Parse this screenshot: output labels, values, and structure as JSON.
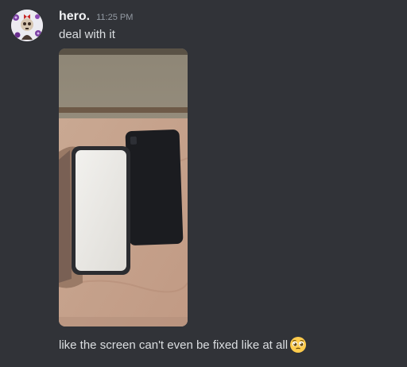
{
  "message": {
    "author": {
      "username": "hero.",
      "avatar_icon": "avatar-skull-flowers-icon"
    },
    "timestamp": "11:25 PM",
    "lines": [
      "deal with it",
      "like the screen can't even be fixed like at all"
    ],
    "attachment": {
      "type": "image",
      "icon": "photo-two-phones"
    },
    "emoji": {
      "name": "pleading-face-icon",
      "glyph": "🥺"
    }
  },
  "colors": {
    "background": "#313338",
    "username": "#f2f3f5",
    "timestamp": "#949ba4",
    "text": "#dbdee1"
  }
}
